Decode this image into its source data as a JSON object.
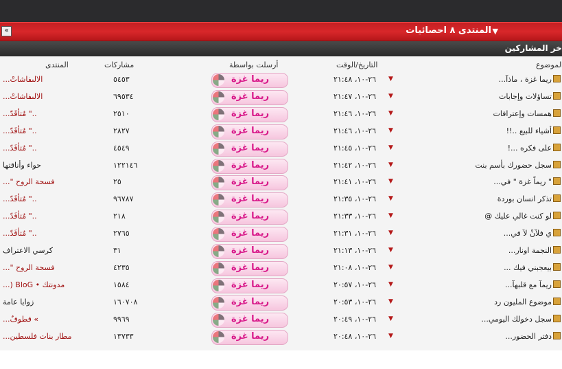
{
  "header": {
    "collapse_icon": "double-chevron-up-icon",
    "title": "المنتدى ٨ احصائيات",
    "section_title": "أخر المشاركين"
  },
  "columns": {
    "topic": "الموضوع",
    "datetime": "التاريخ/الوقت",
    "sent_by": "أرسلت بواسطة",
    "posts": "مشاركات",
    "forum": "المنتدى"
  },
  "rows": [
    {
      "topic": "ريما غزة ، ماذآ...",
      "datetime": "٢٦-١٠، ٢١:٤٨",
      "user": "ريما غزة",
      "posts": "٥٤٥٣",
      "forum": "الالىفاشاتْ..."
    },
    {
      "topic": "تساؤلات وإجابات",
      "datetime": "٢٦-١٠، ٢١:٤٧",
      "user": "ريما غزة",
      "posts": "٦٩٥٣٤",
      "forum": "الالىفاشاتْ..."
    },
    {
      "topic": "همسات وإعترافات",
      "datetime": "٢٦-١٠، ٢١:٤٦",
      "user": "ريما غزة",
      "posts": "٢٥١٠",
      "forum": "..\" مٌتأقَدّ..."
    },
    {
      "topic": "أشياء للبيع ..!!",
      "datetime": "٢٦-١٠، ٢١:٤٦",
      "user": "ريما غزة",
      "posts": "٢٨٢٧",
      "forum": "..\" مٌتأقَدّ..."
    },
    {
      "topic": "على فكره ...!",
      "datetime": "٢٦-١٠، ٢١:٤٥",
      "user": "ريما غزة",
      "posts": "٤٥٤٩",
      "forum": "..\" مٌتأقَدّ..."
    },
    {
      "topic": "سجل حضورك بأسم بنت",
      "datetime": "٢٦-١٠، ٢١:٤٢",
      "user": "ريما غزة",
      "posts": "١٢٢١٤٦",
      "forum": "حواء وأناقتها",
      "forum_dark": true
    },
    {
      "topic": "\" ريماً غزة \" في...",
      "datetime": "٢٦-١٠، ٢١:٤١",
      "user": "ريما غزة",
      "posts": "٢٥",
      "forum": "فسحة الروح \"..."
    },
    {
      "topic": "تذكر انسان بوردة",
      "datetime": "٢٦-١٠، ٢١:٣٥",
      "user": "ريما غزة",
      "posts": "٩٦٧٨٧",
      "forum": "..\" مٌتأقَدّ..."
    },
    {
      "topic": "لو كنت غالي عليك @",
      "datetime": "٢٦-١٠، ٢١:٣٣",
      "user": "ريما غزة",
      "posts": "٢١٨",
      "forum": "..\" مٌتأقَدّ..."
    },
    {
      "topic": "ي فلآنْ لاَ في...",
      "datetime": "٢٦-١٠، ٢١:٣١",
      "user": "ريما غزة",
      "posts": "٢٧٦٥",
      "forum": "..\" مٌتأقَدّ..."
    },
    {
      "topic": "النجمة اونار...",
      "datetime": "٢٦-١٠، ٢١:١٣",
      "user": "ريما غزة",
      "posts": "٣١",
      "forum": "كرسي الاعتراف",
      "forum_dark": true
    },
    {
      "topic": "بيعجبني فيك ...",
      "datetime": "٢٦-١٠، ٢١:٠٨",
      "user": "ريما غزة",
      "posts": "٤٢٣٥",
      "forum": "فسحة الروح \"..."
    },
    {
      "topic": "ريمآ مع قلبهآ...",
      "datetime": "٢٦-١٠، ٢٠:٥٧",
      "user": "ريما غزة",
      "posts": "١٥٨٤",
      "forum": "مدونتك • BloG (..."
    },
    {
      "topic": "موضوع المليون رد",
      "datetime": "٢٦-١٠، ٢٠:٥٣",
      "user": "ريما غزة",
      "posts": "١٦٠٧٠٨",
      "forum": "زوايا عامة",
      "forum_dark": true
    },
    {
      "topic": "سجل دخولك اليومي...",
      "datetime": "٢٦-١٠، ٢٠:٤٩",
      "user": "ريما غزة",
      "posts": "٩٩٦٩",
      "forum": "»‏ قطوفٌ..."
    },
    {
      "topic": "دفتر الحضور...",
      "datetime": "٢٦-١٠، ٢٠:٤٨",
      "user": "ريما غزة",
      "posts": "١٣٧٣٣",
      "forum": "مطار بنات فلسطين..."
    }
  ]
}
